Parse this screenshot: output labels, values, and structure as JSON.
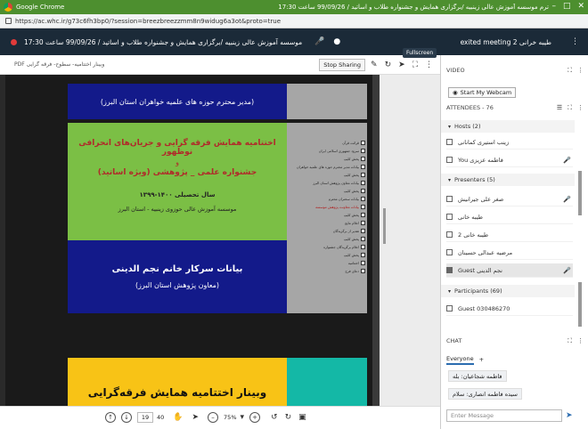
{
  "browser": {
    "app_name": "Google Chrome",
    "window_title": "ترم موسسه آموزش عالی زینبیه /برگزاری همایش و جشنواره طلاب و اساتید / 99/09/26 ساعت 17:30",
    "url": "https://ac.whc.ir/g73c6fh3bp0/?session=breezbreezzmm8n9widug6a3ot&proto=true"
  },
  "meeting_bar": {
    "session_title": "موسسه آموزش عالی زینبیه /برگزاری همایش و جشنواره طلاب و اساتید / 99/09/26 ساعت 17:30",
    "exited_note": "طیبه خرانی 2 exited meeting"
  },
  "content_bar": {
    "pod_title": "PDF وبینار اختتامیه- سطوح- فرقه گرایی",
    "stop_sharing": "Stop Sharing",
    "fullscreen_tip": "Fullscreen"
  },
  "slides": {
    "a_text": "(مدیر محترم حوزه های علمیه خواهران استان البرز)",
    "b_title1": "اختتامیه همایش فرقه گرایی و جریان‌های انحرافی نوظهور",
    "b_and": "و",
    "b_title2": "جشنواره علمی _ پژوهشی (ویژه اساتید)",
    "b_year": "سال تحصیلی ۱۴۰۰-۱۳۹۹",
    "b_inst": "موسسه آموزش عالی حوزوی زینبیه - استان البرز",
    "b_speaker": "بیانات سرکار خانم نجم الدینی",
    "b_role": "(معاون پژوهش استان البرز)",
    "c_text": "وبینار اختتامیه همایش فرقه‌گرایی",
    "toc": [
      {
        "text": "قرائت قرآن",
        "red": false
      },
      {
        "text": "سرود جمهوری اسلامی ایران",
        "red": false
      },
      {
        "text": "پخش کلیپ",
        "red": false
      },
      {
        "text": "بیانات مدیر محترم حوزه های علمیه خواهران",
        "red": false
      },
      {
        "text": "پخش کلیپ",
        "red": false
      },
      {
        "text": "بیانات معاون پژوهش استان البرز",
        "red": false
      },
      {
        "text": "پخش کلیپ",
        "red": false
      },
      {
        "text": "بیانات سخنران محترم",
        "red": false
      },
      {
        "text": "بیانات معاونت پژوهش موسسه",
        "red": true
      },
      {
        "text": "پخش کلیپ",
        "red": false
      },
      {
        "text": "اعلام نتایج",
        "red": false
      },
      {
        "text": "تقدیر از برگزیدگان",
        "red": false
      },
      {
        "text": "پخش کلیپ",
        "red": false
      },
      {
        "text": "اعلام برگزیدگان جشنواره",
        "red": false
      },
      {
        "text": "پخش کلیپ",
        "red": false
      },
      {
        "text": "اختتامیه",
        "red": false
      },
      {
        "text": "دعای فرج",
        "red": false
      }
    ]
  },
  "doc_toolbar": {
    "page_current": "19",
    "page_total": "40",
    "zoom": "75%"
  },
  "sidebar": {
    "video_header": "VIDEO",
    "start_webcam": "Start My Webcam",
    "attendees_header": "ATTENDEES - 76",
    "hosts_label": "Hosts (2)",
    "hosts": [
      {
        "name": "زینب استیری کمانانی",
        "mic": false
      },
      {
        "name": "فاطمه عزیزی You",
        "mic": true
      }
    ],
    "presenters_label": "Presenters (5)",
    "presenters": [
      {
        "name": "صغر علی جیرانیش",
        "mic": true,
        "selected": false
      },
      {
        "name": "طیبه خانی",
        "mic": false,
        "selected": false
      },
      {
        "name": "طیبه خانی 2",
        "mic": false,
        "selected": false
      },
      {
        "name": "مرضیه عبدالی حسینان",
        "mic": false,
        "selected": false
      },
      {
        "name": "نجم الدینی Guest",
        "mic": true,
        "selected": true
      }
    ],
    "participants_label": "Participants (69)",
    "participants": [
      {
        "name": "030486270 Guest"
      }
    ],
    "chat_header": "CHAT",
    "chat_tab": "Everyone",
    "chat_add": "+",
    "chat_messages": [
      "فاطمه شجاعیان: بله",
      "سیده فاطمه انصاری: سلام"
    ],
    "chat_placeholder": "Enter Message"
  }
}
